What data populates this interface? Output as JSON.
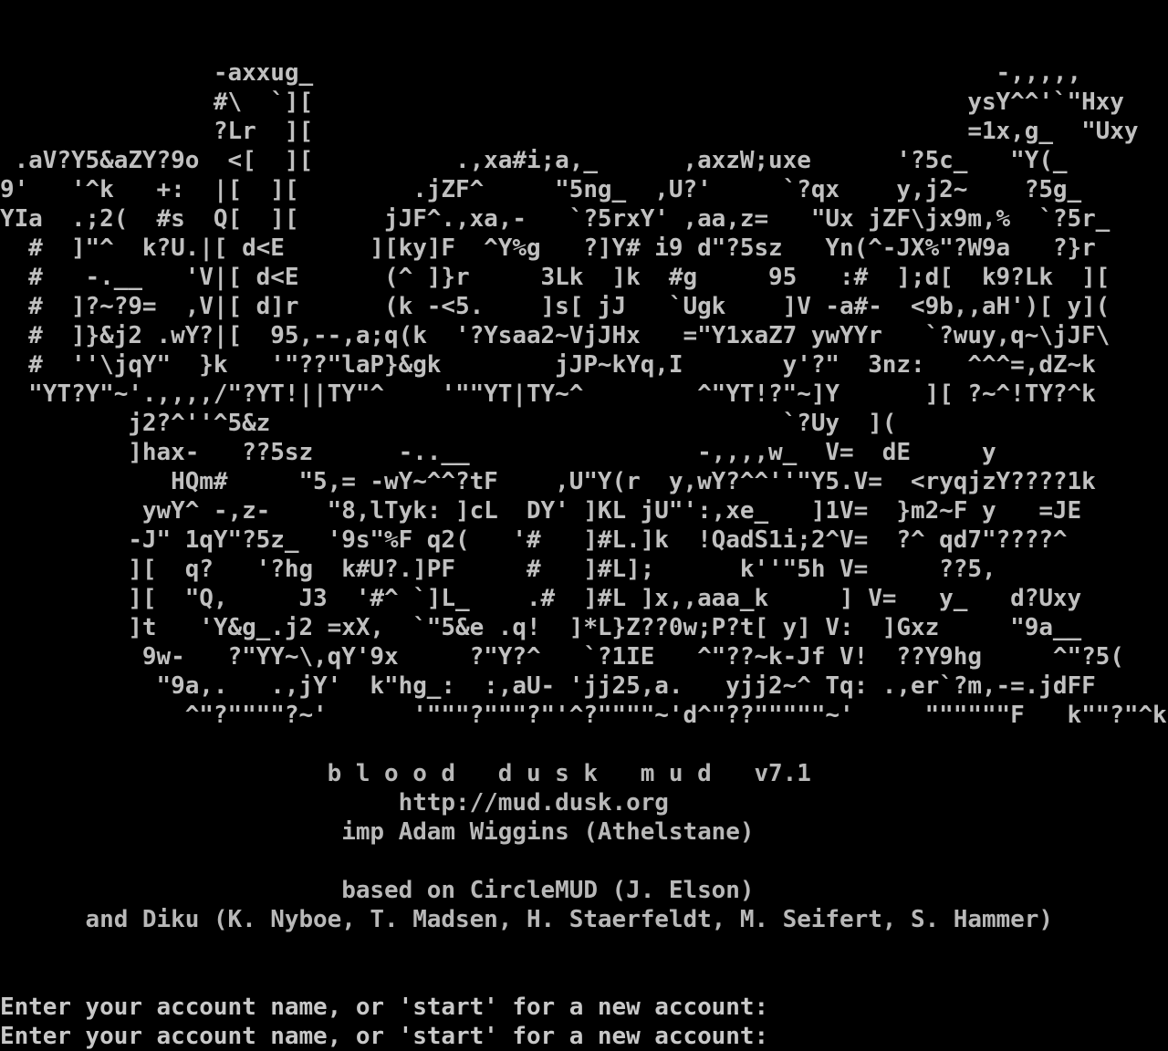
{
  "terminal": {
    "background": "#000000",
    "foreground": "#c0c0c0"
  },
  "art_lines": [
    "               -axxug_                                                -,,,,,",
    "               #\\  `][                                              ysY^^'`\"Hxy",
    "               ?Lr  ][                                              =1x,g_  \"Uxy",
    " .aV?Y5&aZY?9o  <[  ][          .,xa#i;a,_      ,axzW;uxe      '?5c_   \"Y(_",
    "9'   '^k   +:  |[  ][        .jZF^     \"5ng_  ,U?'     `?qx    y,j2~    ?5g_",
    "YIa  .;2(  #s  Q[  ][      jJF^.,xa,-   `?5rxY' ,aa,z=   \"Ux jZF\\jx9m,%  `?5r_",
    "  #  ]\"^  k?U.|[ d<E      ][ky]F  ^Y%g   ?]Y# i9 d\"?5sz   Yn(^-JX%\"?W9a   ?}r",
    "  #   -.__   'V|[ d<E      (^ ]}r     3Lk  ]k  #g     95   :#  ];d[  k9?Lk  ][",
    "  #  ]?~?9=  ,V|[ d]r      (k -<5.    ]s[ jJ   `Ugk    ]V -a#-  <9b,,aH')[ y](",
    "  #  ]}&j2 .wY?|[  95,--,a;q(k  '?Ysaa2~VjJHx   =\"Y1xaZ7 ywYYr   `?wuy,q~\\jJF\\",
    "  #  ''\\jqY\"  }k   '\"??\"laP}&gk        jJP~kYq,I       y'?\"  3nz:   ^^^=,dZ~k",
    "  \"YT?Y\"~'.,,,,/\"?YT!||TY\"^    '\"\"YT|TY~^        ^\"YT!?\"~]Y      ][ ?~^!TY?^k",
    "         j2?^''^5&z                                    `?Uy  ](",
    "         ]hax-   ??5sz      -..__                -,,,,w_  V=  dE     y",
    "            HQm#     \"5,= -wY~^^?tF    ,U\"Y(r  y,wY?^^''\"Y5.V=  <ryqjzY????1k",
    "          ywY^ -,z-    \"8,lTyk: ]cL  DY' ]KL jU\"':,xe_   ]1V=  }m2~F y   =JE",
    "         -J\" 1qY\"?5z_  '9s\"%F q2(   '#   ]#L.]k  !QadS1i;2^V=  ?^ qd7\"????^",
    "         ][  q?   '?hg  k#U?.]PF     #   ]#L];      k''\"5h V=     ??5,",
    "         ][  \"Q,     J3  '#^ `]L_    .#  ]#L ]x,,aaa_k     ] V=   y_   d?Uxy",
    "         ]t   'Y&g_.j2 =xX,  `\"5&e .q!  ]*L}Z??0w;P?t[ y] V:  ]Gxz     \"9a__",
    "          9w-   ?\"YY~\\,qY'9x     ?\"Y?^   `?1IE   ^\"??~k-Jf V!  ??Y9hg     ^\"?5(",
    "           \"9a,.   .,jY'  k\"hg_:  :,aU- 'jj25,a.   yjj2~^ Tq: .,er`?m,-=.jdFF",
    "             ^\"?\"\"\"\"?~'      '\"\"\"?\"\"\"?\"'^?\"\"\"\"~'d^\"??\"\"\"\"\"~'     \"\"\"\"\"\"F   k\"\"?\"^k"
  ],
  "banner": {
    "title": "                       b l o o d   d u s k   m u d   v7.1",
    "url": "                            http://mud.dusk.org",
    "imp": "                        imp Adam Wiggins (Athelstane)",
    "based": "                        based on CircleMUD (J. Elson)",
    "diku": "      and Diku (K. Nyboe, T. Madsen, H. Staerfeldt, M. Seifert, S. Hammer)"
  },
  "prompts": [
    "Enter your account name, or 'start' for a new account:",
    "Enter your account name, or 'start' for a new account:"
  ]
}
